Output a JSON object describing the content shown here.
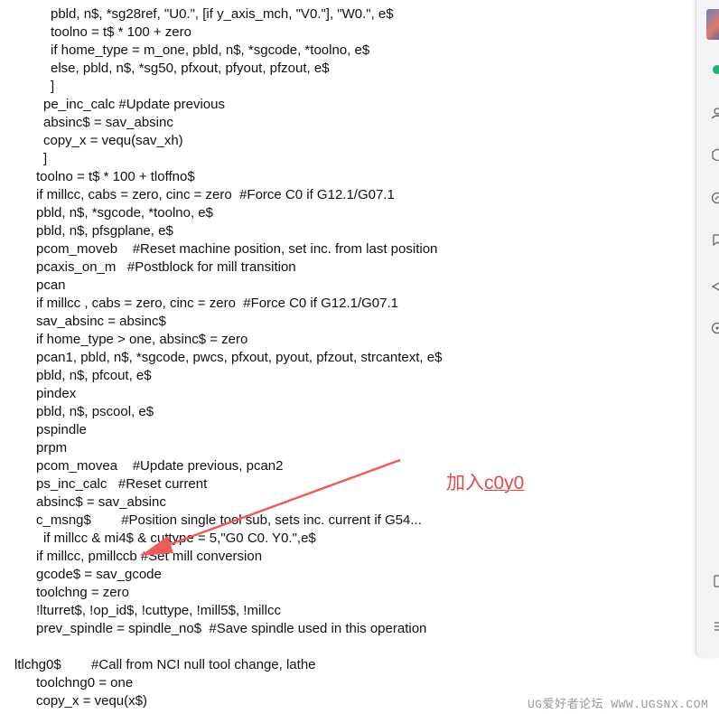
{
  "code_lines": [
    {
      "indent": 56,
      "text": "pbld, n$, *sg28ref, \"U0.\", [if y_axis_mch, \"V0.\"], \"W0.\", e$"
    },
    {
      "indent": 56,
      "text": "toolno = t$ * 100 + zero"
    },
    {
      "indent": 56,
      "text": "if home_type = m_one, pbld, n$, *sgcode, *toolno, e$"
    },
    {
      "indent": 56,
      "text": "else, pbld, n$, *sg50, pfxout, pfyout, pfzout, e$"
    },
    {
      "indent": 56,
      "text": "]"
    },
    {
      "indent": 48,
      "text": "pe_inc_calc #Update previous"
    },
    {
      "indent": 48,
      "text": "absinc$ = sav_absinc"
    },
    {
      "indent": 48,
      "text": "copy_x = vequ(sav_xh)"
    },
    {
      "indent": 48,
      "text": "]"
    },
    {
      "indent": 40,
      "text": "toolno = t$ * 100 + tloffno$"
    },
    {
      "indent": 40,
      "text": "if millcc, cabs = zero, cinc = zero  #Force C0 if G12.1/G07.1"
    },
    {
      "indent": 40,
      "text": "pbld, n$, *sgcode, *toolno, e$"
    },
    {
      "indent": 40,
      "text": "pbld, n$, pfsgplane, e$"
    },
    {
      "indent": 40,
      "text": "pcom_moveb    #Reset machine position, set inc. from last position"
    },
    {
      "indent": 40,
      "text": "pcaxis_on_m   #Postblock for mill transition"
    },
    {
      "indent": 40,
      "text": "pcan"
    },
    {
      "indent": 40,
      "text": "if millcc , cabs = zero, cinc = zero  #Force C0 if G12.1/G07.1"
    },
    {
      "indent": 40,
      "text": "sav_absinc = absinc$"
    },
    {
      "indent": 40,
      "text": "if home_type > one, absinc$ = zero"
    },
    {
      "indent": 40,
      "text": "pcan1, pbld, n$, *sgcode, pwcs, pfxout, pyout, pfzout, strcantext, e$"
    },
    {
      "indent": 40,
      "text": "pbld, n$, pfcout, e$"
    },
    {
      "indent": 40,
      "text": "pindex"
    },
    {
      "indent": 40,
      "text": "pbld, n$, pscool, e$"
    },
    {
      "indent": 40,
      "text": "pspindle"
    },
    {
      "indent": 40,
      "text": "prpm"
    },
    {
      "indent": 40,
      "text": "pcom_movea    #Update previous, pcan2"
    },
    {
      "indent": 40,
      "text": "ps_inc_calc   #Reset current"
    },
    {
      "indent": 40,
      "text": "absinc$ = sav_absinc"
    },
    {
      "indent": 40,
      "text": "c_msng$        #Position single tool sub, sets inc. current if G54..."
    },
    {
      "indent": 48,
      "text": "if millcc & mi4$ & cuttype = 5,\"G0 C0. Y0.\",e$"
    },
    {
      "indent": 40,
      "text": "if millcc, pmillccb #Set mill conversion"
    },
    {
      "indent": 40,
      "text": "gcode$ = sav_gcode"
    },
    {
      "indent": 40,
      "text": "toolchng = zero"
    },
    {
      "indent": 40,
      "text": "!lturret$, !op_id$, !cuttype, !mill5$, !millcc"
    },
    {
      "indent": 40,
      "text": "prev_spindle = spindle_no$  #Save spindle used in this operation"
    },
    {
      "indent": 40,
      "text": ""
    },
    {
      "indent": 16,
      "text": "ltlchg0$        #Call from NCI null tool change, lathe"
    },
    {
      "indent": 40,
      "text": "toolchng0 = one"
    },
    {
      "indent": 40,
      "text": "copy_x = vequ(x$)"
    }
  ],
  "annotation": {
    "prefix": "加入",
    "underlined": "c0y0",
    "color": "#e64a4a"
  },
  "watermark": "UG爱好者论坛 WWW.UGSNX.COM",
  "side_icons": [
    "green-dot-icon",
    "user-icon",
    "box-icon",
    "compass-icon",
    "bookmark-icon",
    "send-icon",
    "help-icon",
    "window-icon",
    "menu-icon"
  ],
  "colors": {
    "code_text": "#111111",
    "annotation": "#e64a4a",
    "arrow": "#ef5b5b",
    "panel": "#f3f3f5"
  }
}
